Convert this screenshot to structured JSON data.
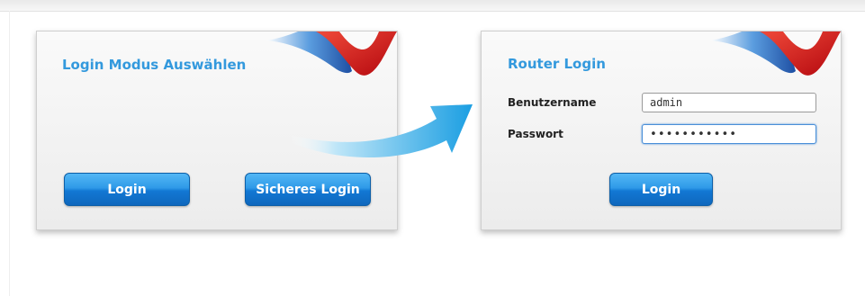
{
  "mode_panel": {
    "title": "Login Modus Auswählen",
    "login_label": "Login",
    "secure_login_label": "Sicheres Login"
  },
  "router_panel": {
    "title": "Router Login",
    "username_label": "Benutzername",
    "username_value": "admin",
    "password_label": "Passwort",
    "password_value": "•••••••••••",
    "login_label": "Login"
  },
  "colors": {
    "title": "#3399dd",
    "button": "#1a7fd8",
    "arrow": "#29a6e6",
    "deco_blue": "#3d7ec9",
    "deco_red": "#d81e1e"
  },
  "icons": [
    "brand-swoosh-icon",
    "arrow-icon"
  ]
}
